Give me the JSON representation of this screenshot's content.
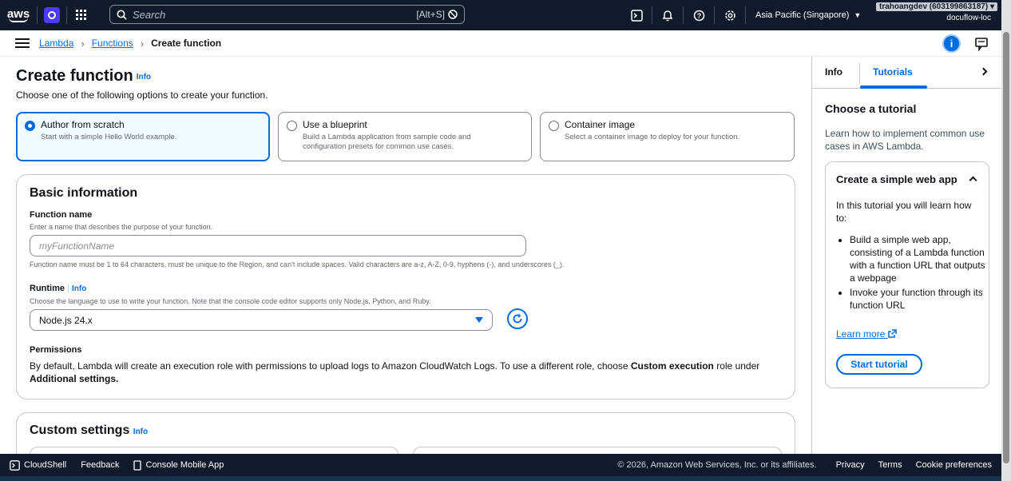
{
  "topnav": {
    "logo": "aws",
    "search_placeholder": "Search",
    "search_shortcut": "[Alt+S]",
    "region": "Asia Pacific (Singapore)",
    "account_id": "trahoangdev (603199863187)",
    "account_name": "docuflow-loc"
  },
  "breadcrumb": {
    "items": [
      "Lambda",
      "Functions",
      "Create function"
    ]
  },
  "page": {
    "title": "Create function",
    "info": "Info",
    "description": "Choose one of the following options to create your function."
  },
  "options": [
    {
      "label": "Author from scratch",
      "desc": "Start with a simple Hello World example.",
      "selected": true
    },
    {
      "label": "Use a blueprint",
      "desc": "Build a Lambda application from sample code and configuration presets for common use cases.",
      "selected": false
    },
    {
      "label": "Container image",
      "desc": "Select a container image to deploy for your function.",
      "selected": false
    }
  ],
  "basic": {
    "title": "Basic information",
    "function_name_label": "Function name",
    "function_name_desc": "Enter a name that describes the purpose of your function.",
    "function_name_placeholder": "myFunctionName",
    "function_name_constraint": "Function name must be 1 to 64 characters, must be unique to the Region, and can't include spaces. Valid characters are a-z, A-Z, 0-9, hyphens (-), and underscores (_).",
    "runtime_label": "Runtime",
    "runtime_info": "Info",
    "runtime_desc": "Choose the language to use to write your function. Note that the console code editor supports only Node.js, Python, and Ruby.",
    "runtime_value": "Node.js 24.x",
    "permissions_label": "Permissions",
    "permissions_text_1": "By default, Lambda will create an execution role with permissions to upload logs to Amazon CloudWatch Logs. To use a different role, choose ",
    "permissions_bold_1": "Custom execution",
    "permissions_text_2": " role under",
    "permissions_bold_2": "Additional settings."
  },
  "custom": {
    "title": "Custom settings",
    "info": "Info"
  },
  "tools": {
    "tab_info": "Info",
    "tab_tutorials": "Tutorials",
    "heading": "Choose a tutorial",
    "intro": "Learn how to implement common use cases in AWS Lambda.",
    "card_title": "Create a simple web app",
    "card_lead": "In this tutorial you will learn how to:",
    "bullets": [
      "Build a simple web app, consisting of a Lambda function with a function URL that outputs a webpage",
      "Invoke your function through its function URL"
    ],
    "learn_more": "Learn more",
    "start": "Start tutorial"
  },
  "footer": {
    "cloudshell": "CloudShell",
    "feedback": "Feedback",
    "mobile_app": "Console Mobile App",
    "copyright": "© 2026, Amazon Web Services, Inc. or its affiliates.",
    "privacy": "Privacy",
    "terms": "Terms",
    "cookies": "Cookie preferences"
  },
  "colors": {
    "nav_bg": "#0f1b2a",
    "accent": "#006ce0",
    "selected_bg": "#f0fbff"
  },
  "icons": [
    "aws-logo",
    "service-icon",
    "grid-icon",
    "search-icon",
    "cloudshell-icon",
    "bell-icon",
    "help-icon",
    "gear-icon",
    "menu-icon",
    "info-icon",
    "chat-icon",
    "refresh-icon",
    "external-link-icon"
  ]
}
